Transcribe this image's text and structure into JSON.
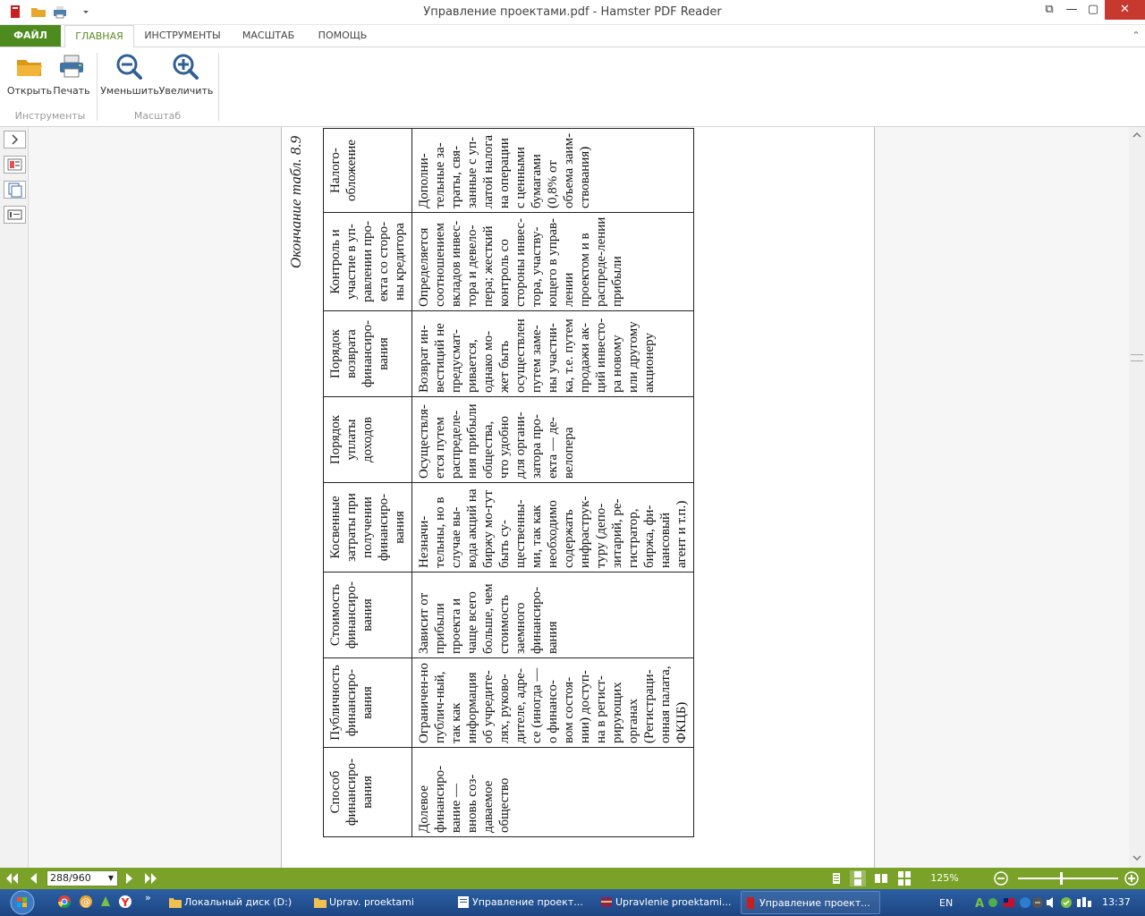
{
  "window": {
    "title": "Управление проектами.pdf - Hamster PDF Reader",
    "controls": {
      "restore_glyph": "⧉",
      "minimize_glyph": "—",
      "maximize_glyph": "▢",
      "close_glyph": "✕"
    }
  },
  "ribbon": {
    "tabs": [
      "ФАЙЛ",
      "ГЛАВНАЯ",
      "ИНСТРУМЕНТЫ",
      "МАСШТАБ",
      "ПОМОЩЬ"
    ],
    "active_tab": "ГЛАВНАЯ",
    "buttons": {
      "open": "Открыть",
      "print": "Печать",
      "zoom_out": "Уменьшить",
      "zoom_in": "Увеличить"
    },
    "groups": {
      "tools": "Инструменты",
      "scale": "Масштаб"
    },
    "collapse_glyph": "⌃"
  },
  "document": {
    "caption": "Окончание табл. 8.9",
    "table": {
      "headers": [
        "Способ финансиро-вания",
        "Публичность финансиро-вания",
        "Стоимость финансиро-вания",
        "Косвенные затраты при получении финансиро-вания",
        "Порядок уплаты доходов",
        "Порядок возврата финансиро-вания",
        "Контроль и участие в уп-равлении про-екта со сторо-ны кредитора",
        "Налого-обложение"
      ],
      "row": [
        "Долевое финансиро-вание — вновь соз-даваемое общество",
        "Ограничен-но публич-ный, так как информация об учредите-лях, руково-дителе, адре-се (иногда — о финансо-вом состоя-нии) доступ-на в регист-рирующих органах (Регистраци-онная палата, ФКЦБ)",
        "Зависит от прибыли проекта и чаще всего больше, чем стоимость заемного финансиро-вания",
        "Незначи-тельны, но в случае вы-вода акций на биржу мо-гут быть су-щественны-ми, так как необходимо содержать инфраструк-туру (депо-зитарий, ре-гистратор, биржа, фи-нансовый агент и т.п.)",
        "Осуществля-ется путем распределе-ния прибыли общества, что удобно для органи-затора про-екта — де-велопера",
        "Возврат ин-вестиций не предусмат-ривается, однако мо-жет быть осуществлен путем заме-ны участни-ка, т.е. путем продажи ак-ций инвесто-ра новому или другому акционеру",
        "Определяется соотношением вкладов инвес-тора и девело-пера; жесткий контроль со стороны инвес-тора, участву-ющего в управ-лении проектом и в распреде-лении прибыли",
        "Дополни-тельные за-траты, свя-занные с уп-латой налога на операции с ценными бумагами (0,8% от объема заим-ствования)"
      ]
    }
  },
  "statusbar": {
    "page_value": "288/960",
    "zoom": "125%",
    "zoom_level_fraction": 0.42
  },
  "taskbar": {
    "items": [
      "Локальный диск (D:)",
      "Uprav. proektami",
      "Управление проект...",
      "Upravlenie proektami...",
      "Управление проект..."
    ],
    "active_index": 4,
    "lang": "EN",
    "time": "13:37",
    "overflow": "»"
  },
  "colors": {
    "accent": "#5a8d23",
    "file_tab": "#4e8b1f",
    "statusbar": "#7aa228",
    "close": "#c7382f",
    "taskbar": "#1d4582"
  }
}
